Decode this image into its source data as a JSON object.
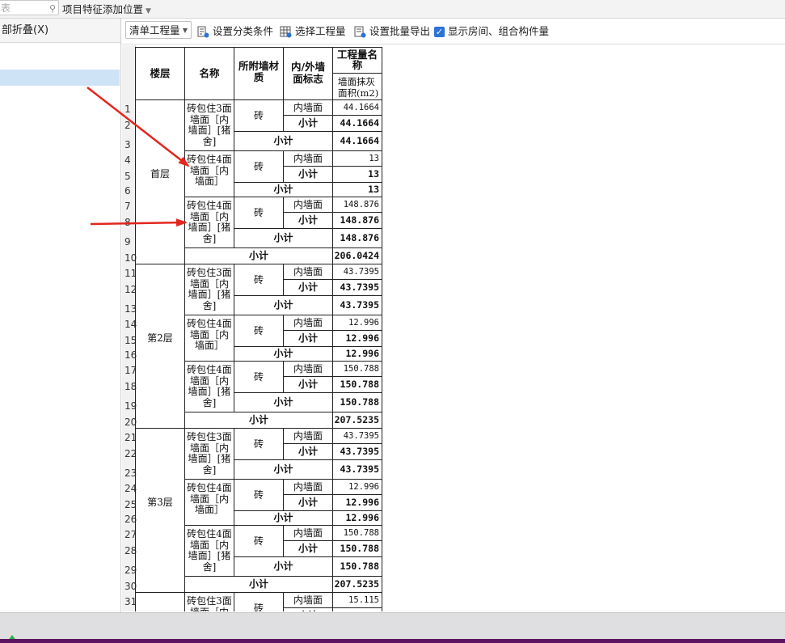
{
  "top": {
    "search_hint": "表",
    "feature_pos": "项目特征添加位置"
  },
  "left": {
    "collapse_label": "部折叠(X)"
  },
  "toolbar": {
    "mode": "清单工程量",
    "set_classify": "设置分类条件",
    "select_qty": "选择工程量",
    "batch_export": "设置批量导出",
    "show_rooms": "显示房间、组合构件量"
  },
  "colors": {
    "arrow": "#e3261e",
    "selected": "#cfe3f7",
    "check": "#2b73d8",
    "bottom": "#5c1460"
  },
  "header": {
    "floor": "楼层",
    "name": "名称",
    "wall_mat": "所附墙材质",
    "inout_a": "内/外墙",
    "inout_b": "面标志",
    "qty_a": "工程量名",
    "qty_b": "称",
    "qty_sub_a": "墙面抹灰",
    "qty_sub_b": "面积(m2)"
  },
  "row_numbers": [
    "1",
    "2",
    "3",
    "4",
    "5",
    "6",
    "7",
    "8",
    "9",
    "10",
    "11",
    "12",
    "13",
    "14",
    "15",
    "16",
    "17",
    "18",
    "19",
    "20",
    "21",
    "22",
    "23",
    "24",
    "25",
    "26",
    "27",
    "28",
    "29",
    "30",
    "31",
    "32"
  ],
  "labels": {
    "material": "砖",
    "inner": "内墙面",
    "small": "小计",
    "subtotal": "小计"
  },
  "floors": [
    {
      "name": "首层",
      "groups": [
        {
          "name": [
            "砖包住3面",
            "墙面［内",
            "墙面］[猪",
            "舍]"
          ],
          "value": "44.1664",
          "small": "44.1664",
          "sub": "44.1664"
        },
        {
          "name": [
            "砖包住4面",
            "墙面［内",
            "墙面］"
          ],
          "value": "13",
          "small": "13",
          "sub": "13"
        },
        {
          "name": [
            "砖包住4面",
            "墙面［内",
            "墙面］[猪",
            "舍]"
          ],
          "value": "148.876",
          "small": "148.876",
          "sub": "148.876"
        }
      ],
      "total": "206.0424"
    },
    {
      "name": "第2层",
      "groups": [
        {
          "name": [
            "砖包住3面",
            "墙面［内",
            "墙面］[猪",
            "舍]"
          ],
          "value": "43.7395",
          "small": "43.7395",
          "sub": "43.7395"
        },
        {
          "name": [
            "砖包住4面",
            "墙面［内",
            "墙面］"
          ],
          "value": "12.996",
          "small": "12.996",
          "sub": "12.996"
        },
        {
          "name": [
            "砖包住4面",
            "墙面［内",
            "墙面］[猪",
            "舍]"
          ],
          "value": "150.788",
          "small": "150.788",
          "sub": "150.788"
        }
      ],
      "total": "207.5235"
    },
    {
      "name": "第3层",
      "groups": [
        {
          "name": [
            "砖包住3面",
            "墙面［内",
            "墙面］[猪",
            "舍]"
          ],
          "value": "43.7395",
          "small": "43.7395",
          "sub": "43.7395"
        },
        {
          "name": [
            "砖包住4面",
            "墙面［内",
            "墙面］"
          ],
          "value": "12.996",
          "small": "12.996",
          "sub": "12.996"
        },
        {
          "name": [
            "砖包住4面",
            "墙面［内",
            "墙面］[猪",
            "舍]"
          ],
          "value": "150.788",
          "small": "150.788",
          "sub": "150.788"
        }
      ],
      "total": "207.5235"
    },
    {
      "name": "",
      "groups": [
        {
          "name": [
            "砖包住3面",
            "墙面［内"
          ],
          "value": "15.115",
          "small": "15.115",
          "sub": ""
        }
      ],
      "total": ""
    }
  ]
}
